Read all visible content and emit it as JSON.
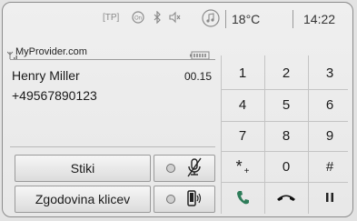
{
  "status": {
    "tp_label": "[TP]",
    "icons": [
      "onstar-icon",
      "bluetooth-icon",
      "mute-speaker-icon",
      "music-note-icon"
    ],
    "temperature": "18°C",
    "time": "14:22"
  },
  "call": {
    "provider": "MyProvider.com",
    "caller_name": "Henry Miller",
    "duration": "00.15",
    "number": "+49567890123"
  },
  "buttons": {
    "favorites": "Stiki",
    "call_history": "Zgodovina klicev"
  },
  "keypad": {
    "keys": [
      "1",
      "2",
      "3",
      "4",
      "5",
      "6",
      "7",
      "8",
      "9",
      "*",
      "0",
      "#"
    ],
    "plus": "+"
  },
  "colors": {
    "background": "#e3e3e3",
    "text": "#1a1a1a",
    "muted": "#8a8a8a",
    "call_accept": "#2e7d5a",
    "call_end": "#111111"
  }
}
